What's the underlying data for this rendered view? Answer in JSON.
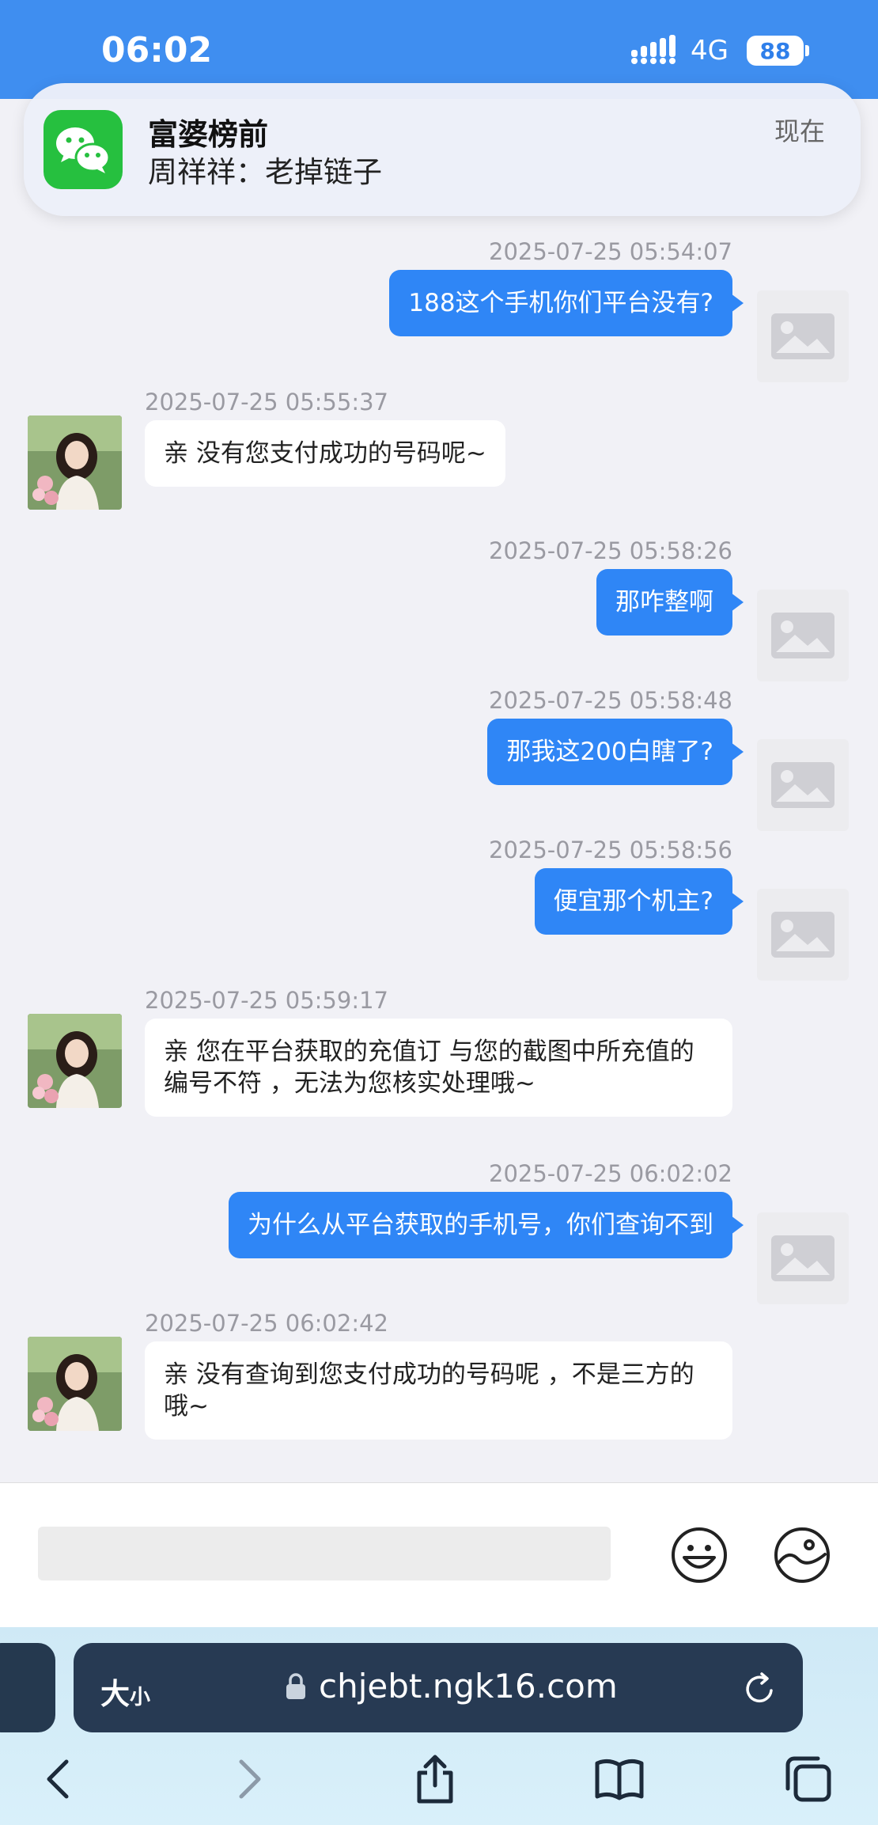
{
  "status_bar": {
    "time": "06:02",
    "network": "4G",
    "battery": "88"
  },
  "notification": {
    "app_icon": "wechat-icon",
    "title": "富婆榜前",
    "message": "周祥祥：老掉链子",
    "time": "现在"
  },
  "messages": [
    {
      "side": "out",
      "timestamp": "2025-07-25 05:54:07",
      "text": "188这个手机你们平台没有?"
    },
    {
      "side": "in",
      "timestamp": "2025-07-25 05:55:37",
      "text": "亲 没有您支付成功的号码呢~"
    },
    {
      "side": "out",
      "timestamp": "2025-07-25 05:58:26",
      "text": "那咋整啊"
    },
    {
      "side": "out",
      "timestamp": "2025-07-25 05:58:48",
      "text": "那我这200白瞎了?"
    },
    {
      "side": "out",
      "timestamp": "2025-07-25 05:58:56",
      "text": "便宜那个机主?"
    },
    {
      "side": "in",
      "timestamp": "2025-07-25 05:59:17",
      "text": "亲 您在平台获取的充值订 与您的截图中所充值的编号不符 ，无法为您核实处理哦~"
    },
    {
      "side": "out",
      "timestamp": "2025-07-25 06:02:02",
      "text": "为什么从平台获取的手机号，你们查询不到"
    },
    {
      "side": "in",
      "timestamp": "2025-07-25 06:02:42",
      "text": "亲 没有查询到您支付成功的号码呢 ，不是三方的哦~"
    }
  ],
  "input_bar": {
    "placeholder": "",
    "emoji_icon": "smiley-icon",
    "image_icon": "image-icon"
  },
  "browser": {
    "text_size_big": "大",
    "text_size_small": "小",
    "url": "chjebt.ngk16.com"
  },
  "colors": {
    "status_bar": "#3f8ef0",
    "outgoing_bubble": "#2f86f6",
    "incoming_bubble": "#ffffff",
    "chat_background": "#f1f1f6",
    "url_bar": "#273a53"
  }
}
